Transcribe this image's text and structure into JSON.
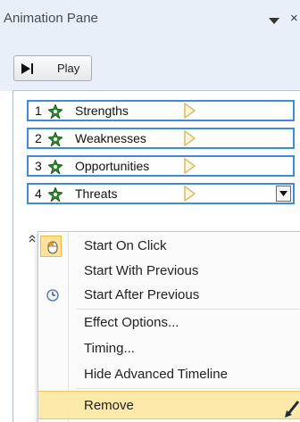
{
  "pane": {
    "title": "Animation Pane",
    "close_glyph": "×",
    "play_label": "Play"
  },
  "animation_items": [
    {
      "number": "1",
      "name": "Strengths"
    },
    {
      "number": "2",
      "name": "Weaknesses"
    },
    {
      "number": "3",
      "name": "Opportunities"
    },
    {
      "number": "4",
      "name": "Threats"
    }
  ],
  "context_menu": {
    "items": [
      {
        "label": "Start On Click",
        "icon": "mouse-click-icon"
      },
      {
        "label": "Start With Previous"
      },
      {
        "label": "Start After Previous",
        "icon": "clock-icon"
      },
      {
        "label": "Effect Options..."
      },
      {
        "label": "Timing..."
      },
      {
        "label": "Hide Advanced Timeline"
      },
      {
        "label": "Remove"
      }
    ]
  },
  "colors": {
    "item_border": "#3e8bd8",
    "effect_star": "#2f8a2f",
    "menu_highlight": "#fde9a9"
  },
  "icons": [
    "play-icon",
    "effect-star-icon",
    "timing-bar-icon",
    "dropdown-arrow-icon",
    "mouse-click-icon",
    "clock-icon",
    "collapse-icon",
    "pane-menu-icon",
    "close-icon"
  ]
}
